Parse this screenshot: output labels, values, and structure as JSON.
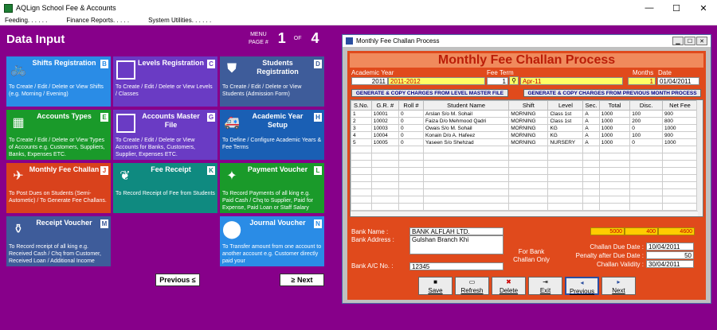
{
  "window": {
    "title": "AQLign School Fee & Accounts",
    "min": "—",
    "max": "☐",
    "close": "✕"
  },
  "menu": [
    "Feeding. . . . . .",
    "Finance Reports. . . . .",
    "System Utilities. . . . . ."
  ],
  "data_input": {
    "title": "Data Input",
    "menu_page_label_1": "MENU",
    "menu_page_label_2": "PAGE #",
    "current_page": "1",
    "of_label": "OF",
    "total_pages": "4",
    "previous_label": "Previous ≤",
    "next_label": "≥ Next"
  },
  "tiles": [
    {
      "title": "Shifts Registration",
      "key": "B",
      "desc": "To Create / Edit / Delete or View Shifts (e.g. Morning / Evening)",
      "color": "#2a8ce6",
      "icon": "bicycle-icon",
      "glyph": "🚲"
    },
    {
      "title": "Levels Registration",
      "key": "C",
      "desc": "To Create / Edit / Delete or View Levels / Classes",
      "color": "#6a3bc4",
      "icon": "square-icon",
      "glyph": ""
    },
    {
      "title": "Students Registration",
      "key": "D",
      "desc": "To Create / Edit / Delete or View Students (Admission Form)",
      "color": "#3e5c9a",
      "icon": "shield-icon",
      "glyph": "⛊"
    },
    {
      "title": "Accounts Types",
      "key": "E",
      "desc": "To Create / Edit / Delete or View Types of Accounts e.g. Customers, Suppliers, Banks, Expenses ETC.",
      "color": "#1a9a2a",
      "icon": "tiles-icon",
      "glyph": "▦"
    },
    {
      "title": "Accounts Master File",
      "key": "G",
      "desc": "To Create / Edit / Delete or View Accounts for Banks, Customers, Supplier, Expenses ETC.",
      "color": "#6a3bc4",
      "icon": "square-icon",
      "glyph": ""
    },
    {
      "title": "Academic Year Setup",
      "key": "H",
      "desc": "To Define / Configure Academic Years & Fee Terms",
      "color": "#1a5fb4",
      "icon": "ambulance-icon",
      "glyph": "🚑"
    },
    {
      "title": "Monthly Fee Challan",
      "key": "J",
      "desc": "To Post Dues on Students (Semi-Autometic) / To Generate Fee Challans.",
      "color": "#d9421c",
      "icon": "plane-icon",
      "glyph": "✈"
    },
    {
      "title": "Fee Receipt",
      "key": "K",
      "desc": "To Record Receipt of Fee from Students",
      "color": "#0f8a80",
      "icon": "leaf-icon",
      "glyph": "❦"
    },
    {
      "title": "Payment Voucher",
      "key": "L",
      "desc": "To Record Payments of all king e.g. Paid Cash / Chq to Supplier, Paid for Expense, Paid Loan or Staff Salary",
      "color": "#1a9a2a",
      "icon": "compass-icon",
      "glyph": "✦"
    },
    {
      "title": "Receipt Voucher",
      "key": "M",
      "desc": "To Record receipt of all king e.g. Received Cash / Chq from Customer, Received Loan / Additional Income",
      "color": "#3e5c9a",
      "icon": "bottle-icon",
      "glyph": "⚱"
    },
    {
      "title": "Journal Voucher",
      "key": "N",
      "desc": "To Transfer amount from one account to another account e.g. Customer directly paid your",
      "color": "#2a8ce6",
      "icon": "circle-icon",
      "glyph": "⬤"
    }
  ],
  "dialog": {
    "title": "Monthly Fee Challan Process",
    "header": "Monthly Fee Challan Process",
    "labels": {
      "academic_year": "Academic Year",
      "fee_term": "Fee Term",
      "months": "Months",
      "date": "Date"
    },
    "academic_year_code": "2011",
    "academic_year_name": "2011-2012",
    "fee_term_code": "1",
    "fee_term_name": "Apr-11",
    "months": "1",
    "date": "01/04/2011",
    "btn_level_master": "GENERATE & COPY CHARGES FROM LEVEL MASTER FILE",
    "btn_prev_month": "GENERATE & COPY CHARGES FROM PREVIOUS MONTH PROCESS",
    "columns": [
      "S.No.",
      "G.R. #",
      "Roll #",
      "Student Name",
      "Shift",
      "Level",
      "Sec.",
      "Total",
      "Disc.",
      "Net Fee"
    ],
    "rows": [
      [
        "1",
        "10001",
        "0",
        "Arslan S/o M. Sohail",
        "MORNING",
        "Class 1st",
        "A",
        "1000",
        "100",
        "900"
      ],
      [
        "2",
        "10002",
        "0",
        "Faiza D/o Mehmood Qadri",
        "MORNING",
        "Class 1st",
        "A",
        "1000",
        "200",
        "800"
      ],
      [
        "3",
        "10003",
        "0",
        "Owais S/o M. Sohail",
        "MORNING",
        "KG",
        "A",
        "1000",
        "0",
        "1000"
      ],
      [
        "4",
        "10004",
        "0",
        "Konain D/o A. Hafeez",
        "MORNING",
        "KG",
        "A",
        "1000",
        "100",
        "900"
      ],
      [
        "5",
        "10005",
        "0",
        "Yaseen S/o Shehzad",
        "MORNING",
        "NURSERY",
        "A",
        "1000",
        "0",
        "1000"
      ]
    ],
    "totals": {
      "total": "5000",
      "disc": "400",
      "net": "4600"
    },
    "bank_name_label": "Bank Name :",
    "bank_name": "BANK ALFLAH LTD.",
    "bank_address_label": "Bank Address :",
    "bank_address": "Gulshan Branch Khi",
    "bank_ac_label": "Bank A/C No. :",
    "bank_ac": "12345",
    "for_bank_line1": "For Bank",
    "for_bank_line2": "Challan Only",
    "due_date_label": "Challan Due Date :",
    "due_date": "10/04/2011",
    "penalty_label": "Penalty after Due Date :",
    "penalty": "50",
    "validity_label": "Challan Validity :",
    "validity": "30/04/2011",
    "buttons": {
      "save": "Save",
      "refresh": "Refresh",
      "delete": "Delete",
      "exit": "Exit",
      "previous": "Previous",
      "next": "Next"
    }
  }
}
